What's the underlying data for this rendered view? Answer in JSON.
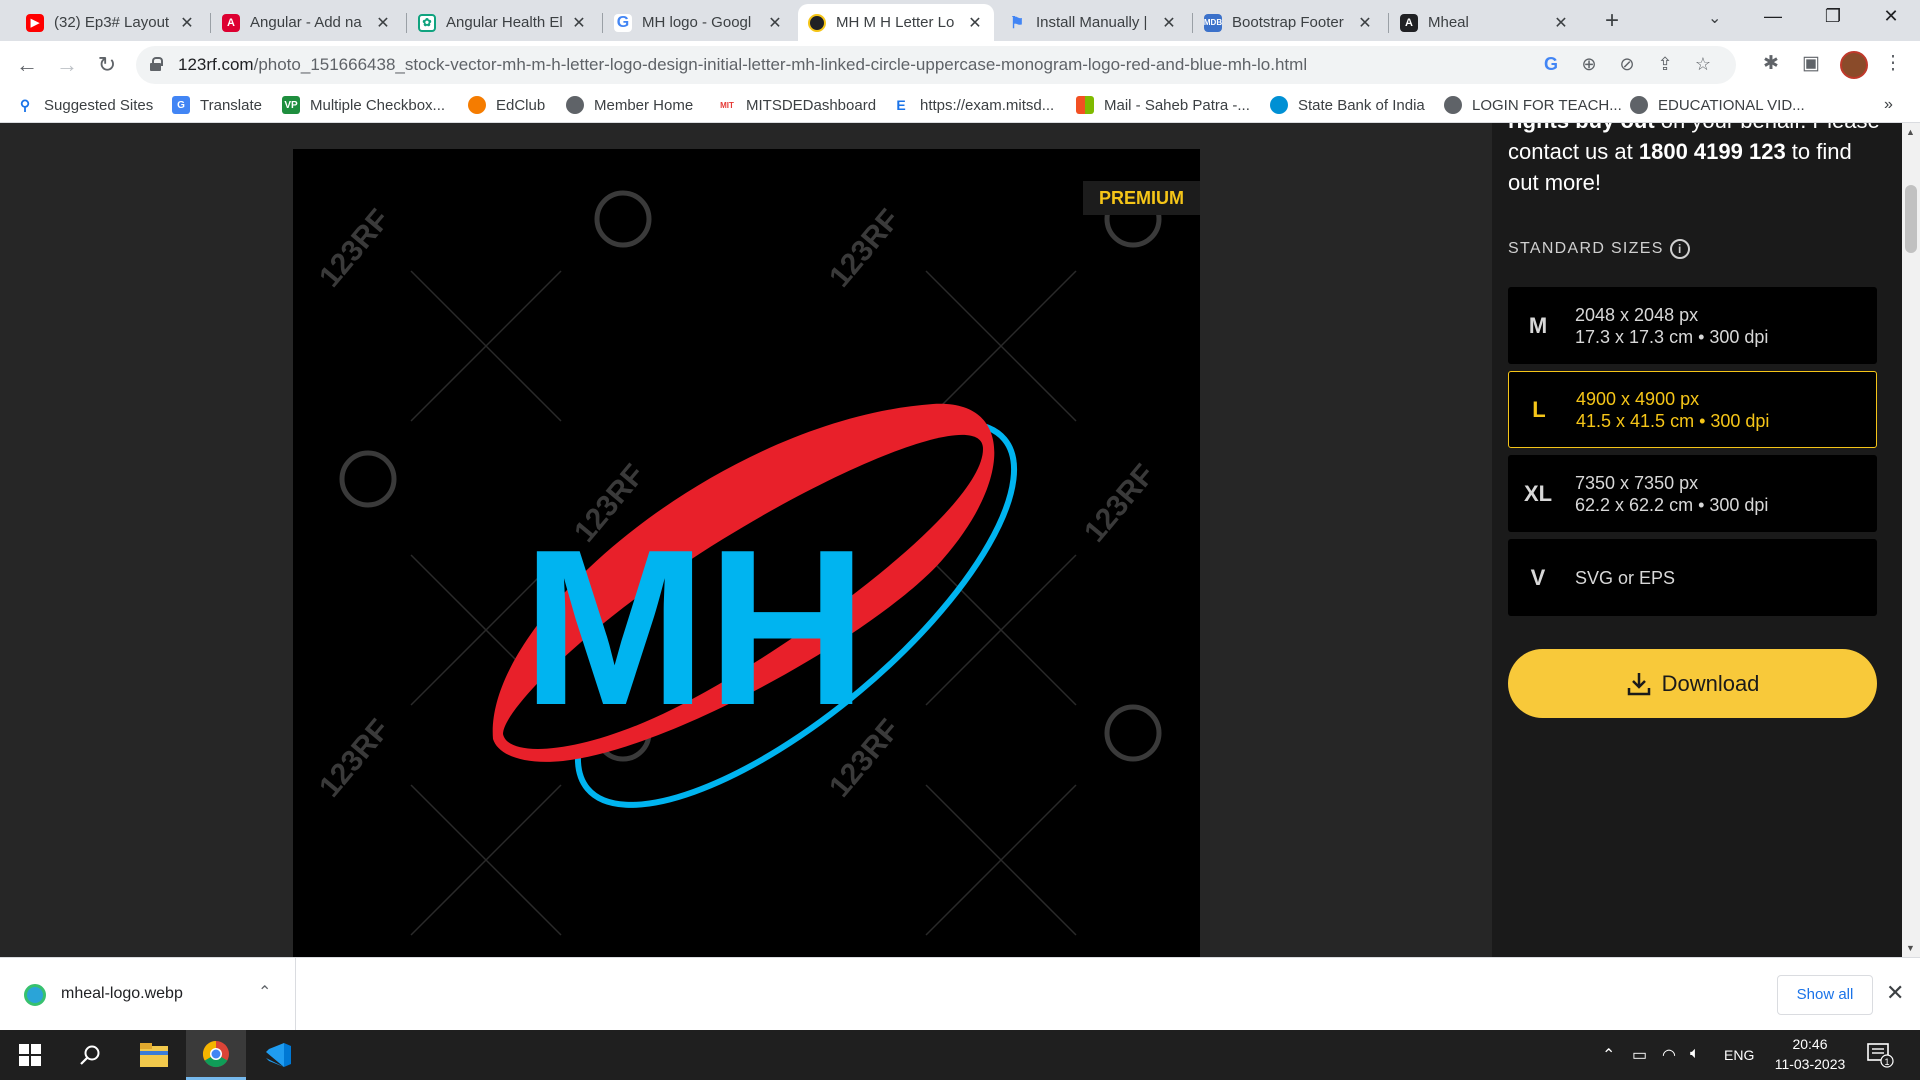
{
  "tabs": [
    {
      "label": "(32) Ep3# Layout",
      "favicon": "youtube-icon",
      "color": "#ff0000"
    },
    {
      "label": "Angular - Add na",
      "favicon": "angular-icon",
      "color": "#dd0031"
    },
    {
      "label": "Angular Health El",
      "favicon": "chatgpt-icon",
      "color": "#10a37f"
    },
    {
      "label": "MH logo - Googl",
      "favicon": "google-icon",
      "color": "#4285f4"
    },
    {
      "label": "MH M H Letter Lo",
      "favicon": "123rf-icon",
      "color": "#f5c518",
      "active": true
    },
    {
      "label": "Install Manually |",
      "favicon": "flag-icon",
      "color": "#4285f4"
    },
    {
      "label": "Bootstrap Footer",
      "favicon": "mdb-icon",
      "color": "#3b71ca"
    },
    {
      "label": "Mheal",
      "favicon": "angular-icon",
      "color": "#202124"
    }
  ],
  "address": {
    "host": "123rf.com",
    "path": "/photo_151666438_stock-vector-mh-m-h-letter-logo-design-initial-letter-mh-linked-circle-uppercase-monogram-logo-red-and-blue-mh-lo.html"
  },
  "bookmarks": [
    {
      "label": "Suggested Sites",
      "icon": "search-icon",
      "color": "#1a73e8"
    },
    {
      "label": "Translate",
      "icon": "translate-icon",
      "color": "#4285f4"
    },
    {
      "label": "Multiple Checkbox...",
      "icon": "vp-icon",
      "color": "#1e8e3e",
      "glyph": "VP"
    },
    {
      "label": "EdClub",
      "icon": "edclub-icon",
      "color": "#f57c00"
    },
    {
      "label": "Member Home",
      "icon": "globe-icon",
      "color": "#5f6368"
    },
    {
      "label": "MITSDEDashboard",
      "icon": "mit-icon",
      "color": "#e53935",
      "glyph": "MIT"
    },
    {
      "label": "https://exam.mitsd...",
      "icon": "exam-icon",
      "color": "#1a73e8",
      "glyph": "E"
    },
    {
      "label": "Mail - Saheb Patra -...",
      "icon": "microsoft-icon",
      "color": "#f25022"
    },
    {
      "label": "State Bank of India",
      "icon": "sbi-icon",
      "color": "#0090d4"
    },
    {
      "label": "LOGIN FOR TEACH...",
      "icon": "globe-icon",
      "color": "#5f6368"
    },
    {
      "label": "EDUCATIONAL VID...",
      "icon": "globe-icon",
      "color": "#5f6368"
    }
  ],
  "image": {
    "premium_badge": "PREMIUM",
    "watermark": "123RF",
    "logo_text": "MH",
    "colors": {
      "blue": "#00b4f0",
      "red": "#e8202a"
    }
  },
  "sidebar": {
    "promo_line1": "rights buy out",
    "promo_line1_rest": " on your behalf. Please",
    "promo_line2_a": "contact us at ",
    "promo_phone": "1800 4199 123",
    "promo_line2_b": " to find",
    "promo_line3": "out more!",
    "standard_sizes_label": "STANDARD SIZES",
    "sizes": [
      {
        "code": "M",
        "line1": "2048 x 2048 px",
        "line2": "17.3 x 17.3 cm • 300 dpi"
      },
      {
        "code": "L",
        "line1": "4900 x 4900 px",
        "line2": "41.5 x 41.5 cm • 300 dpi",
        "selected": true
      },
      {
        "code": "XL",
        "line1": "7350 x 7350 px",
        "line2": "62.2 x 62.2 cm • 300 dpi"
      },
      {
        "code": "V",
        "line1": "SVG or EPS",
        "line2": ""
      }
    ],
    "download_label": "Download",
    "accent": "#f8c93a"
  },
  "downloads": {
    "filename": "mheal-logo.webp",
    "show_all": "Show all"
  },
  "taskbar": {
    "lang": "ENG",
    "time": "20:46",
    "date": "11-03-2023",
    "notifications": "1"
  }
}
